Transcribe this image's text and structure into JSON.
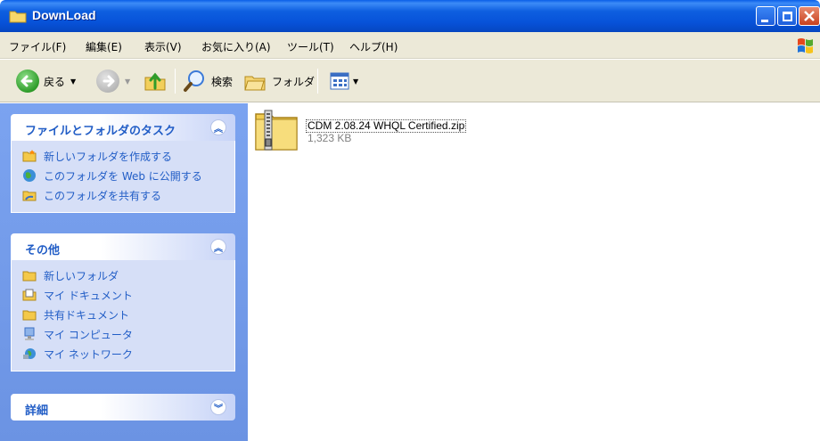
{
  "window": {
    "title": "DownLoad"
  },
  "menu": [
    "ファイル(F)",
    "編集(E)",
    "表示(V)",
    "お気に入り(A)",
    "ツール(T)",
    "ヘルプ(H)"
  ],
  "toolbar": {
    "back_label": "戻る",
    "search_label": "検索",
    "folders_label": "フォルダ"
  },
  "tasks_panel": {
    "title": "ファイルとフォルダのタスク",
    "items": [
      {
        "label": "新しいフォルダを作成する",
        "icon": "new-folder-icon"
      },
      {
        "label": "このフォルダを Web に公開する",
        "icon": "web-publish-icon"
      },
      {
        "label": "このフォルダを共有する",
        "icon": "share-folder-icon"
      }
    ]
  },
  "other_panel": {
    "title": "その他",
    "items": [
      {
        "label": "新しいフォルダ",
        "icon": "folder-icon"
      },
      {
        "label": "マイ ドキュメント",
        "icon": "my-documents-icon"
      },
      {
        "label": "共有ドキュメント",
        "icon": "shared-documents-icon"
      },
      {
        "label": "マイ コンピュータ",
        "icon": "my-computer-icon"
      },
      {
        "label": "マイ ネットワーク",
        "icon": "my-network-icon"
      }
    ]
  },
  "details_panel": {
    "title": "詳細"
  },
  "files": [
    {
      "name": "CDM 2.08.24 WHQL Certified.zip",
      "size": "1,323 KB",
      "icon": "zip-folder-icon"
    }
  ],
  "colors": {
    "titlebar": "#0752d9",
    "pane_bg": "#6b93e3",
    "link": "#215dc6",
    "chrome": "#ece9d8"
  }
}
